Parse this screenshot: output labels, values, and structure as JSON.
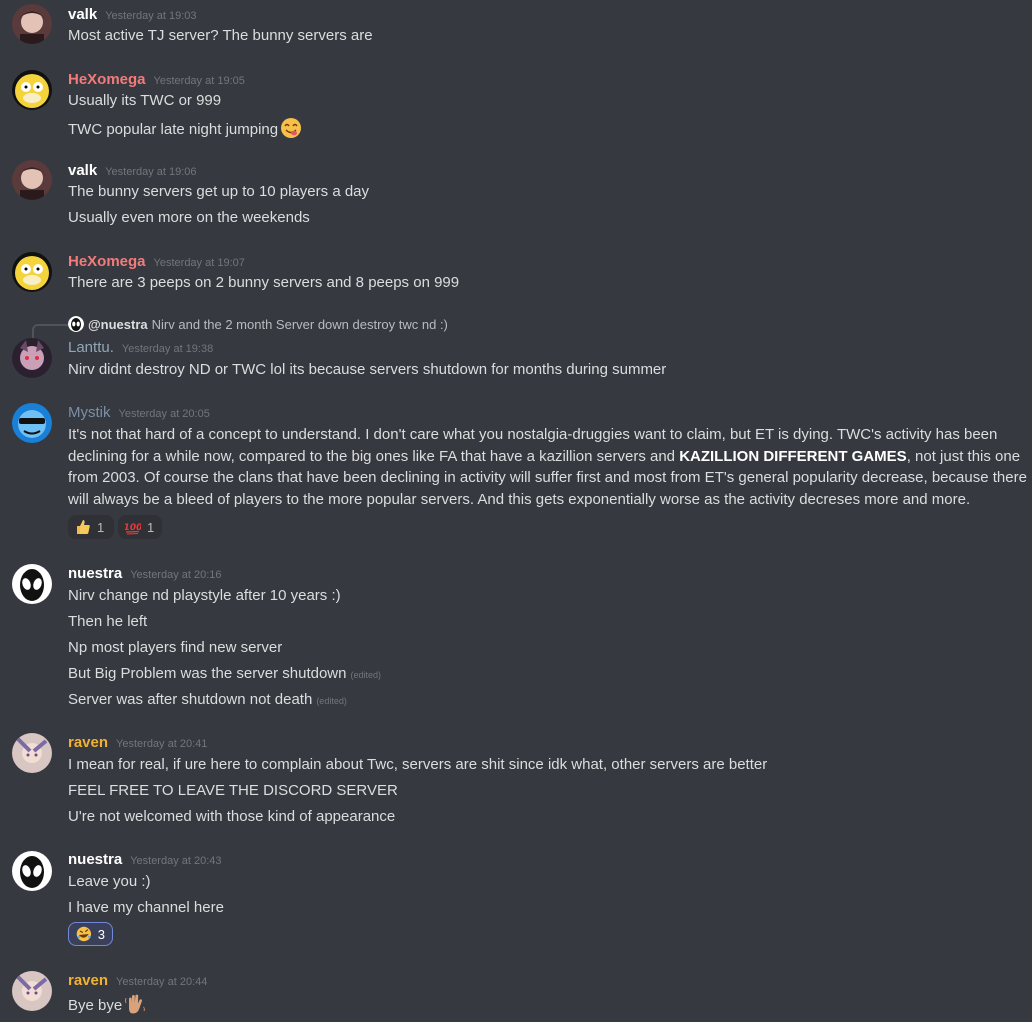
{
  "messages": [
    {
      "author": "valk",
      "color": "#ffffff",
      "time": "Yesterday at 19:03",
      "avatar_icon": "anime-character-avatar",
      "lines": [
        "Most active TJ server? The bunny servers are"
      ]
    },
    {
      "author": "HeXomega",
      "color": "#f47b7b",
      "time": "Yesterday at 19:05",
      "avatar_icon": "psyduck-avatar",
      "lines": [
        "Usually its TWC or 999",
        "TWC popular late night jumping"
      ]
    },
    {
      "author": "valk",
      "color": "#ffffff",
      "time": "Yesterday at 19:06",
      "avatar_icon": "anime-character-avatar",
      "lines": [
        "The bunny servers get up to 10 players a day",
        "Usually even more on the weekends"
      ]
    },
    {
      "author": "HeXomega",
      "color": "#f47b7b",
      "time": "Yesterday at 19:07",
      "avatar_icon": "psyduck-avatar",
      "lines": [
        "There are 3 peeps on 2 bunny servers and 8 peeps on 999"
      ]
    },
    {
      "author": "Lanttu.",
      "color": "#8fa7b8",
      "time": "Yesterday at 19:38",
      "avatar_icon": "anime-character-avatar",
      "reply": {
        "mention": "@nuestra",
        "text": "Nirv and the 2 month Server down destroy twc nd :)"
      },
      "lines": [
        "Nirv didnt destroy ND or TWC lol its because servers shutdown for months during summer"
      ]
    },
    {
      "author": "Mystik",
      "color": "#7c8fa4",
      "time": "Yesterday at 20:05",
      "avatar_icon": "cool-face-sunglasses-avatar",
      "para_before": "It's not that hard of a concept to understand. I don't care what you nostalgia-druggies want to claim, but ET is dying. TWC's activity has been declining for a while now, compared to the big ones like FA that have a kazillion servers and ",
      "para_bold": "KAZILLION DIFFERENT GAMES",
      "para_after": ", not just this one from 2003. Of course the clans that have been declining in activity will suffer first and most from ET's general popularity decrease, because there will always be a bleed of players to the more popular servers. And this gets exponentially worse as the activity decreses more and more.",
      "reactions": [
        {
          "emoji": "thumbs-up",
          "count": "1"
        },
        {
          "emoji": "hundred-points",
          "count": "1"
        }
      ]
    },
    {
      "author": "nuestra",
      "color": "#ffffff",
      "time": "Yesterday at 20:16",
      "avatar_icon": "alien-avatar",
      "lines": [
        "Nirv change nd playstyle after 10 years :)",
        "Then he left",
        "Np most players find new server",
        "But Big Problem was the server shutdown",
        "Server was after shutdown not death"
      ],
      "edited_label": "(edited)"
    },
    {
      "author": "raven",
      "color": "#f0b232",
      "time": "Yesterday at 20:41",
      "avatar_icon": "anime-character-avatar",
      "lines": [
        "I mean for real, if ure here to complain about Twc, servers are shit since idk what, other servers are better",
        "FEEL FREE TO LEAVE THE DISCORD SERVER",
        "U're not welcomed with those kind of appearance"
      ]
    },
    {
      "author": "nuestra",
      "color": "#ffffff",
      "time": "Yesterday at 20:43",
      "avatar_icon": "alien-avatar",
      "lines": [
        "Leave you :)",
        "I have my channel here"
      ],
      "reactions": [
        {
          "emoji": "rolling-laughing",
          "count": "3"
        }
      ]
    },
    {
      "author": "raven",
      "color": "#f0b232",
      "time": "Yesterday at 20:44",
      "avatar_icon": "anime-character-avatar",
      "lines": [
        "Bye bye"
      ]
    }
  ]
}
